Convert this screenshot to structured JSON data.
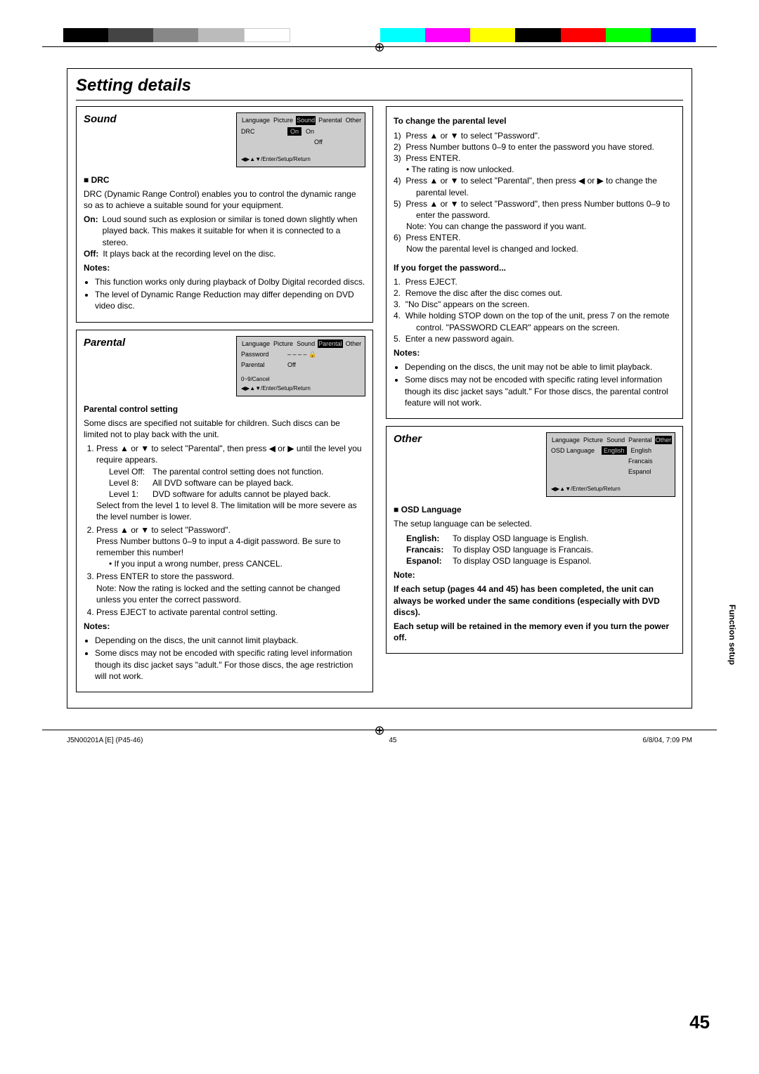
{
  "title": "Setting details",
  "sideTab": "Function setup",
  "pageNumber": "45",
  "footer": {
    "left": "J5N00201A [E] (P45-46)",
    "mid": "45",
    "right": "6/8/04, 7:09 PM"
  },
  "sound": {
    "heading": "Sound",
    "osd": {
      "tabs": [
        "Language",
        "Picture",
        "Sound",
        "Parental",
        "Other"
      ],
      "sel": "Sound",
      "row1": [
        "DRC",
        "On",
        "On"
      ],
      "row2": "Off",
      "nav": "◀▶▲▼/Enter/Setup/Return"
    },
    "drcHead": "■ DRC",
    "drcBody": "DRC (Dynamic Range Control) enables you to control the dynamic range so as to achieve a suitable sound for your equipment.",
    "onLabel": "On:",
    "onText": "Loud sound such as explosion or similar is toned down slightly when played back. This makes it suitable for when it is connected to a stereo.",
    "offLabel": "Off:",
    "offText": "It plays back at the recording level on the disc.",
    "notesHead": "Notes:",
    "notes": [
      "This function works only during playback of Dolby Digital recorded discs.",
      "The level of Dynamic Range Reduction may differ depending on DVD video disc."
    ]
  },
  "parental": {
    "heading": "Parental",
    "osd": {
      "tabs": [
        "Language",
        "Picture",
        "Sound",
        "Parental",
        "Other"
      ],
      "sel": "Parental",
      "row1": [
        "Password",
        "– – – – 🔒"
      ],
      "row2": [
        "Parental",
        "Off"
      ],
      "note": "0~9/Cancel",
      "nav": "◀▶▲▼/Enter/Setup/Return"
    },
    "pcsHead": "Parental control setting",
    "pcsBody": "Some discs are specified not suitable for children. Such discs can be limited not to play back with the unit.",
    "step1a": "Press ▲ or ▼ to select \"Parental\", then press ◀ or ▶ until the level you require appears.",
    "levels": [
      [
        "Level Off:",
        "The parental control setting does not function."
      ],
      [
        "Level 8:",
        "All DVD software can be played back."
      ],
      [
        "Level 1:",
        "DVD software for adults cannot be played back."
      ]
    ],
    "levelNote": "Select from the level 1 to level 8. The limitation will be more severe as the level number is lower.",
    "step2a": "Press ▲ or ▼ to select \"Password\".",
    "step2b": "Press Number buttons 0–9 to input a 4-digit password. Be sure to remember this number!",
    "step2c": "If you input a wrong number, press CANCEL.",
    "step3a": "Press ENTER to store the password.",
    "step3b": "Note: Now the rating is locked and the setting cannot be changed unless you enter the correct password.",
    "step4": "Press EJECT to activate parental control setting.",
    "notesHead": "Notes:",
    "notes": [
      "Depending on the discs, the unit cannot limit playback.",
      "Some discs may not be encoded with specific rating level information though its disc jacket says \"adult.\" For those discs, the age restriction will not work."
    ]
  },
  "right": {
    "changeHead": "To change the parental level",
    "c1": "Press ▲ or ▼ to select \"Password\".",
    "c2a": "Press Number buttons 0–9 to enter the password you have stored.",
    "c3a": "Press ENTER.",
    "c3b": "The rating is now unlocked.",
    "c4": "Press ▲ or ▼ to select \"Parental\", then press ◀ or ▶ to change the parental level.",
    "c5a": "Press ▲ or ▼ to select \"Password\", then press Number buttons 0–9 to enter the password.",
    "c5b": "Note: You can change the password if you want.",
    "c6a": "Press ENTER.",
    "c6b": "Now the parental level is changed and locked.",
    "forgetHead": "If you forget the password...",
    "f1": "Press EJECT.",
    "f2": "Remove the disc after the disc comes out.",
    "f3": "\"No Disc\" appears on the screen.",
    "f4": "While holding STOP down on the top of the unit, press 7 on the remote control. \"PASSWORD CLEAR\" appears on the screen.",
    "f5": "Enter a new password again.",
    "notesHead": "Notes:",
    "notes": [
      "Depending on the discs, the unit may not be able to limit playback.",
      "Some discs may not be encoded with specific rating level information though its disc jacket says \"adult.\" For those discs, the parental control feature will not work."
    ]
  },
  "other": {
    "heading": "Other",
    "osd": {
      "tabs": [
        "Language",
        "Picture",
        "Sound",
        "Parental",
        "Other"
      ],
      "sel": "Other",
      "row1": [
        "OSD Language",
        "English",
        "English"
      ],
      "row2": "Francais",
      "row3": "Espanol",
      "nav": "◀▶▲▼/Enter/Setup/Return"
    },
    "osdLangHead": "■ OSD Language",
    "osdLangBody": "The setup language can be selected.",
    "langs": [
      [
        "English:",
        "To display OSD language is English."
      ],
      [
        "Francais:",
        "To display OSD language is Francais."
      ],
      [
        "Espanol:",
        "To display OSD language is Espanol."
      ]
    ],
    "noteHead": "Note:",
    "noteBody1": "If each setup (pages 44 and 45) has been completed, the unit can always be worked under the same conditions (especially with DVD discs).",
    "noteBody2": "Each setup will be retained in the memory even if you turn the power off."
  }
}
